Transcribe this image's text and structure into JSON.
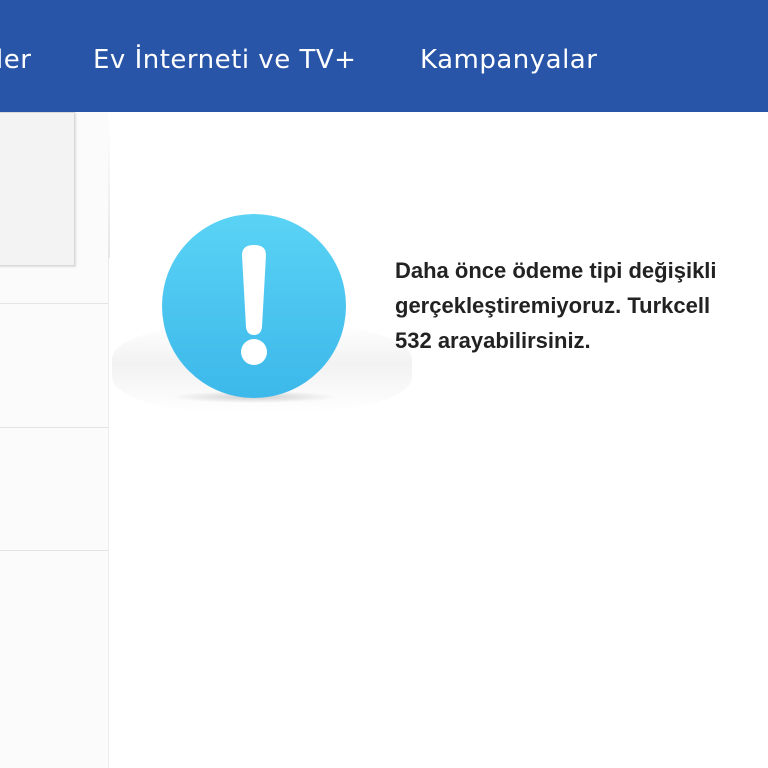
{
  "header": {
    "nav_items": [
      {
        "label": "ler"
      },
      {
        "label": "Ev İnterneti ve TV+"
      },
      {
        "label": "Kampanyalar"
      }
    ],
    "bg_color": "#2855a8"
  },
  "alert": {
    "icon": "exclamation-circle-icon",
    "icon_color": "#4ec7f0",
    "message_lines": [
      "Daha önce ödeme tipi değişikli",
      "gerçekleştiremiyoruz. Turkcell",
      "532 arayabilirsiniz."
    ]
  }
}
